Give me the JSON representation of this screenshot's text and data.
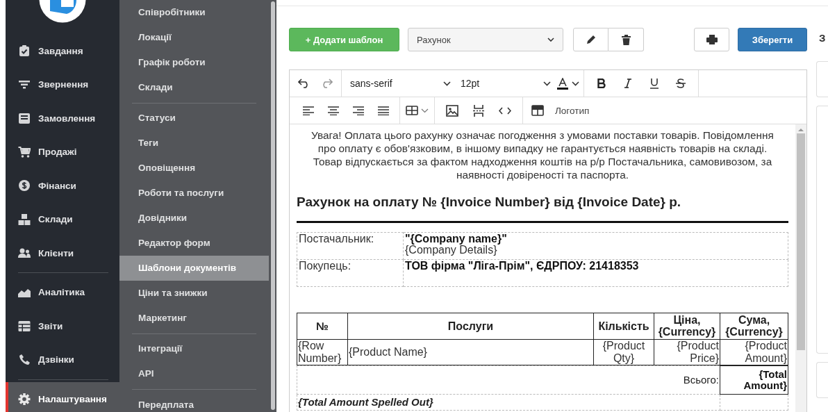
{
  "sidebar": {
    "groups": [
      {
        "items": [
          {
            "label": "Завдання",
            "selected": false
          },
          {
            "label": "Звернення",
            "selected": false
          },
          {
            "label": "Замовлення",
            "selected": false
          },
          {
            "label": "Продажі",
            "selected": false
          },
          {
            "label": "Фінанси",
            "selected": false
          },
          {
            "label": "Склади",
            "selected": false
          },
          {
            "label": "Клієнти",
            "selected": false
          }
        ]
      },
      {
        "items": [
          {
            "label": "Аналітика",
            "selected": false
          },
          {
            "label": "Звіти",
            "selected": false
          },
          {
            "label": "Дзвінки",
            "selected": false
          }
        ]
      },
      {
        "items": [
          {
            "label": "Налаштування",
            "selected": true
          }
        ]
      }
    ]
  },
  "submenu": {
    "groups": [
      {
        "items": [
          {
            "label": "Співробітники",
            "selected": false
          },
          {
            "label": "Локації",
            "selected": false
          },
          {
            "label": "Графік роботи",
            "selected": false
          },
          {
            "label": "Склади",
            "selected": false
          }
        ]
      },
      {
        "items": [
          {
            "label": "Статуси",
            "selected": false
          },
          {
            "label": "Теги",
            "selected": false
          },
          {
            "label": "Оповіщення",
            "selected": false
          },
          {
            "label": "Роботи та послуги",
            "selected": false
          },
          {
            "label": "Довідники",
            "selected": false
          },
          {
            "label": "Редактор форм",
            "selected": false
          },
          {
            "label": "Шаблони документів",
            "selected": true
          },
          {
            "label": "Ціни та знижки",
            "selected": false
          },
          {
            "label": "Маркетинг",
            "selected": false
          }
        ]
      },
      {
        "items": [
          {
            "label": "Інтеграції",
            "selected": false
          },
          {
            "label": "API",
            "selected": false
          }
        ]
      },
      {
        "items": [
          {
            "label": "Передплата",
            "selected": false
          }
        ]
      }
    ]
  },
  "toolbar": {
    "add_button": "+ Додати шаблон",
    "template_select": "Рахунок",
    "save_button": "Зберегти"
  },
  "right_panel": {
    "title": "З"
  },
  "editor": {
    "font_family": "sans-serif",
    "font_size": "12pt",
    "logo_button": "Логотип",
    "document": {
      "notice": "Увага! Оплата цього рахунку означає погодження з умовами поставки товарів. Повідомлення про оплату є обов'язковим, в іншому випадку не гарантується наявність товарів на складі. Товар відпускається за фактом надходження коштів на р/р Постачальника, самовивозом, за наявності довіреності та паспорта.",
      "title": "Рахунок на оплату № {Invoice Number} від {Invoice Date} р.",
      "parties": [
        {
          "label": "Постачальник:",
          "lines": [
            {
              "text": "\"{Company name}\"",
              "bold": true
            },
            {
              "text": "{Company Details}",
              "bold": false
            }
          ]
        },
        {
          "label": "Покупець:",
          "lines": [
            {
              "text": "ТОВ фірма \"Ліга-Прім\", ЄДРПОУ: 21418353",
              "bold": true
            }
          ]
        }
      ],
      "items_table": {
        "columns": [
          "№",
          "Послуги",
          "Кількість",
          "Ціна, {Currency}",
          "Сума, {Currency}"
        ],
        "rows": [
          [
            "{Row Number}",
            "{Product Name}",
            "{Product Qty}",
            "{Product Price}",
            "{Product Amount}"
          ]
        ],
        "total_label": "Всього:",
        "total_value": "{Total Amount}"
      },
      "amount_in_words": "{Total Amount Spelled Out}"
    }
  }
}
